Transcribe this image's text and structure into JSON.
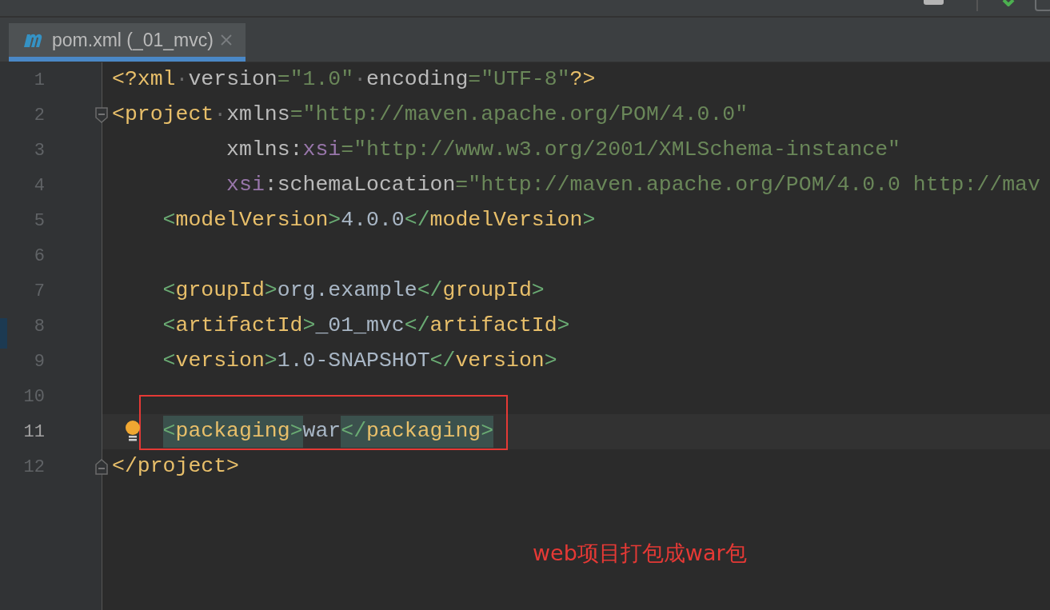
{
  "tabs": [
    {
      "label": "pom.xml (_01_mvc)",
      "selected": true
    }
  ],
  "editor": {
    "lines": [
      {
        "number": "1",
        "kind": "root",
        "tokens": [
          {
            "kind": "tag",
            "text": "<?xml"
          },
          {
            "kind": "space",
            "text": "·"
          },
          {
            "kind": "attr",
            "text": "version"
          },
          {
            "kind": "string",
            "text": "=\"1.0\""
          },
          {
            "kind": "space",
            "text": "·"
          },
          {
            "kind": "attr",
            "text": "encoding"
          },
          {
            "kind": "string",
            "text": "=\"UTF-8\""
          },
          {
            "kind": "tag",
            "text": "?>"
          }
        ]
      },
      {
        "number": "2",
        "kind": "root",
        "fold_start": true,
        "tokens": [
          {
            "kind": "tag",
            "text": "<project"
          },
          {
            "kind": "space",
            "text": "·"
          },
          {
            "kind": "attr",
            "text": "xmlns"
          },
          {
            "kind": "string",
            "text": "=\"http://maven.apache.org/POM/4.0.0\""
          }
        ]
      },
      {
        "number": "3",
        "kind": "attribute",
        "tokens": [
          {
            "kind": "attr",
            "text": "xmlns:"
          },
          {
            "kind": "ns",
            "text": "xsi"
          },
          {
            "kind": "string",
            "text": "=\"http://www.w3.org/2001/XMLSchema-instance\""
          }
        ]
      },
      {
        "number": "4",
        "kind": "attribute",
        "tokens": [
          {
            "kind": "ns",
            "text": "xsi"
          },
          {
            "kind": "attr",
            "text": ":schemaLocation"
          },
          {
            "kind": "string",
            "text": "=\"http://maven.apache.org/POM/4.0.0 http://mav"
          }
        ]
      },
      {
        "number": "5",
        "kind": "element",
        "tokens": [
          {
            "kind": "bracket",
            "text": "<"
          },
          {
            "kind": "tag",
            "text": "modelVersion"
          },
          {
            "kind": "bracket",
            "text": ">"
          },
          {
            "kind": "text",
            "text": "4.0.0"
          },
          {
            "kind": "bracket",
            "text": "</"
          },
          {
            "kind": "tag",
            "text": "modelVersion"
          },
          {
            "kind": "bracket",
            "text": ">"
          }
        ]
      },
      {
        "number": "6",
        "kind": "blank"
      },
      {
        "number": "7",
        "kind": "element",
        "tokens": [
          {
            "kind": "bracket",
            "text": "<"
          },
          {
            "kind": "tag",
            "text": "groupId"
          },
          {
            "kind": "bracket",
            "text": ">"
          },
          {
            "kind": "text",
            "text": "org.example"
          },
          {
            "kind": "bracket",
            "text": "</"
          },
          {
            "kind": "tag",
            "text": "groupId"
          },
          {
            "kind": "bracket",
            "text": ">"
          }
        ]
      },
      {
        "number": "8",
        "kind": "element",
        "tokens": [
          {
            "kind": "bracket",
            "text": "<"
          },
          {
            "kind": "tag",
            "text": "artifactId"
          },
          {
            "kind": "bracket",
            "text": ">"
          },
          {
            "kind": "text",
            "text": "_01_mvc"
          },
          {
            "kind": "bracket",
            "text": "</"
          },
          {
            "kind": "tag",
            "text": "artifactId"
          },
          {
            "kind": "bracket",
            "text": ">"
          }
        ]
      },
      {
        "number": "9",
        "kind": "element",
        "tokens": [
          {
            "kind": "bracket",
            "text": "<"
          },
          {
            "kind": "tag",
            "text": "version"
          },
          {
            "kind": "bracket",
            "text": ">"
          },
          {
            "kind": "text",
            "text": "1.0-SNAPSHOT"
          },
          {
            "kind": "bracket",
            "text": "</"
          },
          {
            "kind": "tag",
            "text": "version"
          },
          {
            "kind": "bracket",
            "text": ">"
          }
        ]
      },
      {
        "number": "10",
        "kind": "blank"
      },
      {
        "number": "11",
        "kind": "element",
        "current": true,
        "intention": true,
        "tokens": [
          {
            "kind": "bracket",
            "text": "<",
            "matched": true
          },
          {
            "kind": "tag",
            "text": "packaging",
            "matched": true
          },
          {
            "kind": "bracket",
            "text": ">",
            "matched": true
          },
          {
            "kind": "text",
            "text": "war"
          },
          {
            "kind": "bracket",
            "text": "</",
            "matched": true
          },
          {
            "kind": "tag",
            "text": "packaging",
            "matched": true
          },
          {
            "kind": "bracket",
            "text": ">",
            "matched": true
          }
        ]
      },
      {
        "number": "12",
        "kind": "root",
        "fold_end": true,
        "tokens": [
          {
            "kind": "tag",
            "text": "</project>"
          }
        ]
      }
    ]
  },
  "annotation": {
    "text": "web项目打包成war包"
  }
}
